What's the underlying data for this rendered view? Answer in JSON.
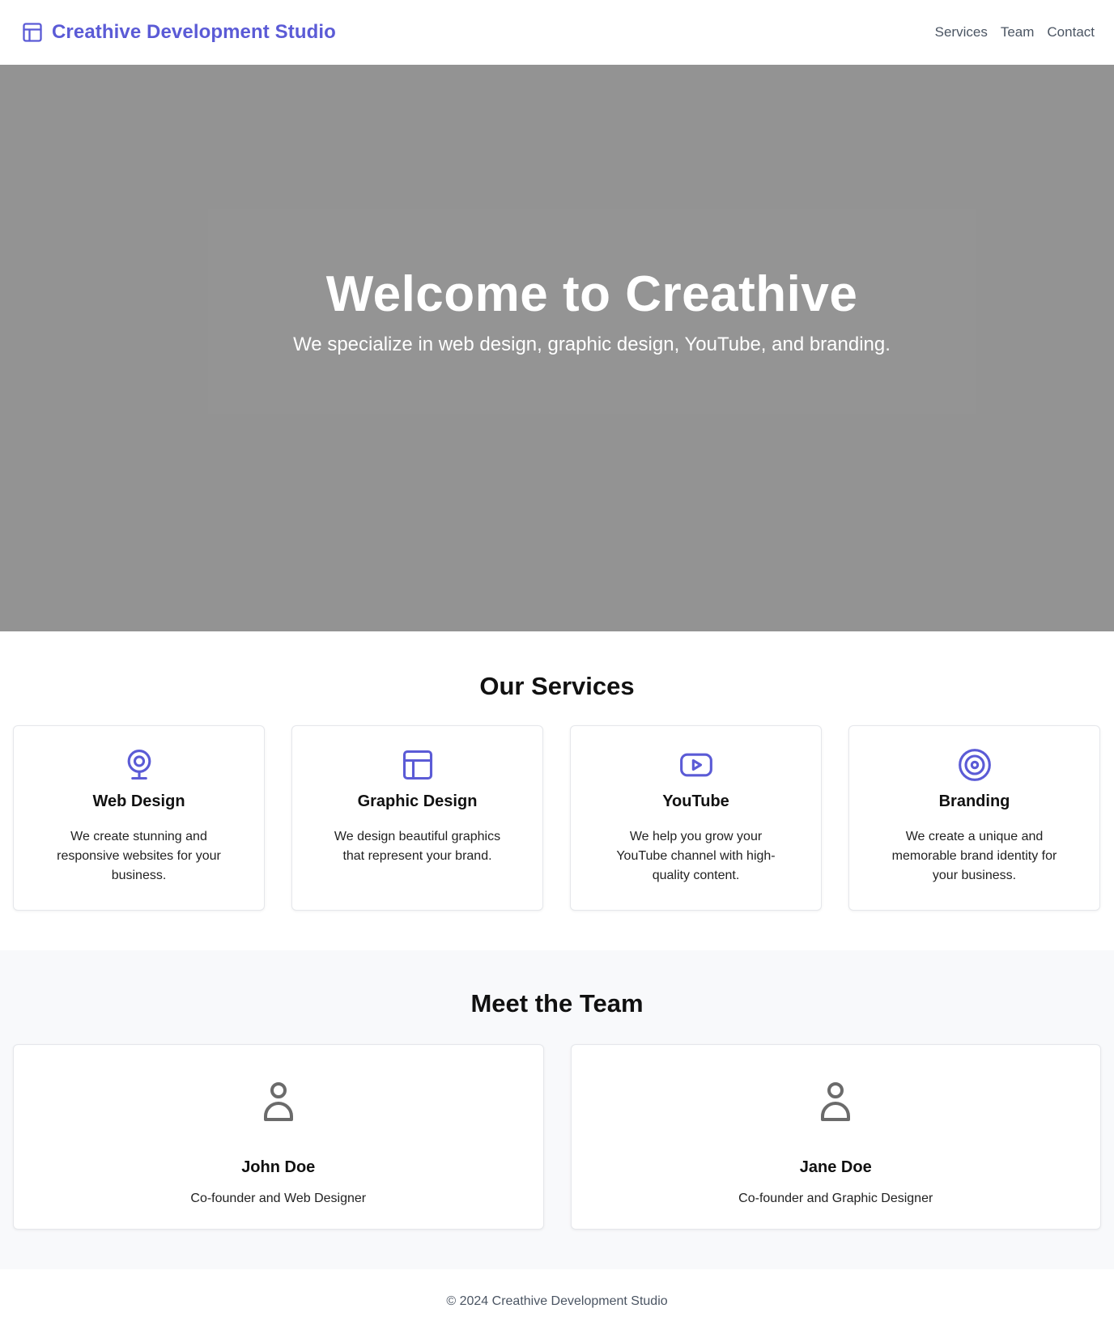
{
  "brand": {
    "name": "Creathive Development Studio",
    "icon": "layout-icon",
    "color": "#5b5bd6"
  },
  "nav": {
    "items": [
      "Services",
      "Team",
      "Contact"
    ]
  },
  "hero": {
    "title": "Welcome to Creathive",
    "subtitle": "We specialize in web design, graphic design, YouTube, and branding.",
    "background": "#939393"
  },
  "services": {
    "title": "Our Services",
    "items": [
      {
        "icon": "webcam-icon",
        "title": "Web Design",
        "description": "We create stunning and responsive websites for your business."
      },
      {
        "icon": "layout-icon",
        "title": "Graphic Design",
        "description": "We design beautiful graphics that represent your brand."
      },
      {
        "icon": "youtube-icon",
        "title": "YouTube",
        "description": "We help you grow your YouTube channel with high-quality content."
      },
      {
        "icon": "target-icon",
        "title": "Branding",
        "description": "We create a unique and memorable brand identity for your business."
      }
    ]
  },
  "team": {
    "title": "Meet the Team",
    "members": [
      {
        "icon": "user-icon",
        "name": "John Doe",
        "role": "Co-founder and Web Designer"
      },
      {
        "icon": "user-icon",
        "name": "Jane Doe",
        "role": "Co-founder and Graphic Designer"
      }
    ]
  },
  "footer": {
    "text": "© 2024 Creathive Development Studio"
  },
  "colors": {
    "accent": "#5b5bd6",
    "muted": "#4b5563",
    "icon_gray": "#6b6b6b"
  }
}
